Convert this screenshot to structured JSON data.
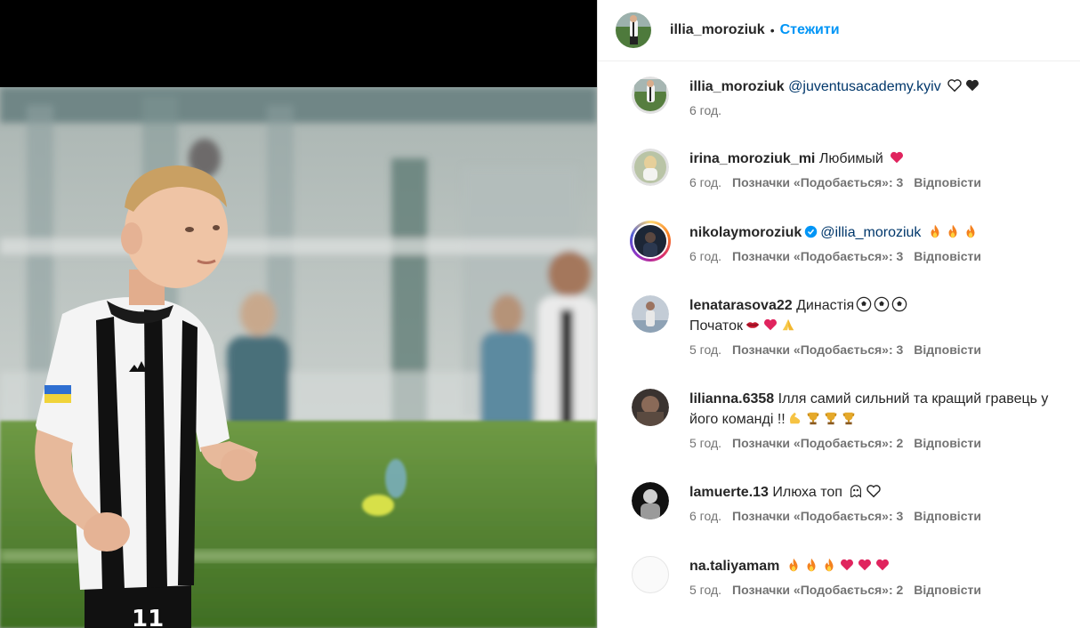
{
  "header": {
    "username": "illia_moroziuk",
    "separator": "•",
    "follow_label": "Стежити"
  },
  "comments": [
    {
      "username": "illia_moroziuk",
      "text": "",
      "mention": "@juventusacademy.kyiv",
      "emojis": [
        "white-heart",
        "black-heart"
      ],
      "time": "6 год.",
      "likes": "",
      "reply": ""
    },
    {
      "username": "irina_moroziuk_mi",
      "text": "Любимый",
      "mention": "",
      "emojis": [
        "red-heart"
      ],
      "time": "6 год.",
      "likes": "Позначки «Подобається»: 3",
      "reply": "Відповісти"
    },
    {
      "username": "nikolaymoroziuk",
      "text": "",
      "mention": "@illia_moroziuk",
      "emojis": [
        "fire",
        "fire",
        "fire"
      ],
      "time": "6 год.",
      "likes": "Позначки «Подобається»: 3",
      "reply": "Відповісти",
      "verified": true
    },
    {
      "username": "lenatarasova22",
      "text": "Династія",
      "text2": "Початок",
      "mention": "",
      "emojis": [
        "soccer-ball",
        "soccer-ball",
        "soccer-ball"
      ],
      "emojis2": [
        "kiss-lips",
        "red-heart",
        "folded-hands"
      ],
      "time": "5 год.",
      "likes": "Позначки «Подобається»: 3",
      "reply": "Відповісти"
    },
    {
      "username": "lilianna.6358",
      "text": "Ілля самий сильний та кращий гравець у його команді !!",
      "mention": "",
      "emojis": [
        "flexed-biceps",
        "trophy",
        "trophy",
        "trophy"
      ],
      "time": "5 год.",
      "likes": "Позначки «Подобається»: 2",
      "reply": "Відповісти"
    },
    {
      "username": "lamuerte.13",
      "text": "Илюха топ",
      "mention": "",
      "emojis": [
        "ghost",
        "white-heart"
      ],
      "time": "6 год.",
      "likes": "Позначки «Подобається»: 3",
      "reply": "Відповісти"
    },
    {
      "username": "na.taliyamam",
      "text": "",
      "mention": "",
      "emojis": [
        "fire",
        "fire",
        "fire",
        "red-heart",
        "red-heart",
        "red-heart"
      ],
      "time": "5 год.",
      "likes": "Позначки «Подобається»: 2",
      "reply": "Відповісти"
    }
  ],
  "colors": {
    "follow": "#0095f6",
    "mention": "#00376b",
    "meta": "#737373"
  }
}
